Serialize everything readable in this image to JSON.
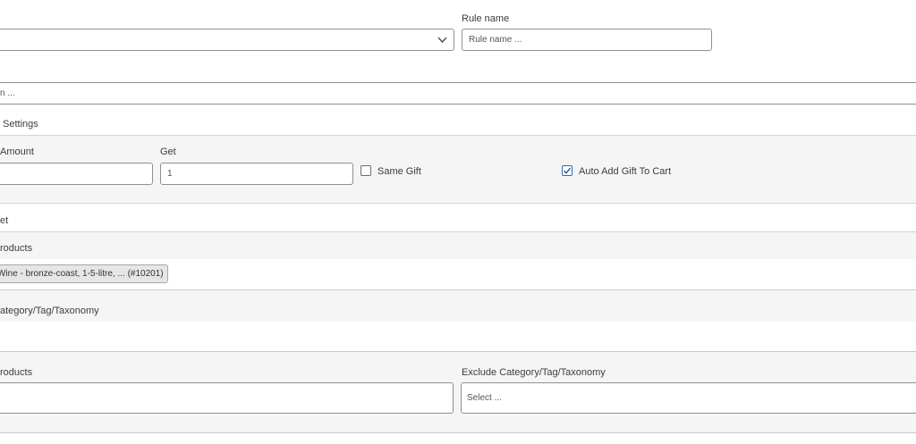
{
  "top_row": {
    "rule_name_label": "Rule name",
    "rule_name_placeholder": "Rule name ..."
  },
  "description_field": {
    "placeholder": "n ..."
  },
  "settings_header": {
    "label": "Settings"
  },
  "gift_settings": {
    "amount_label": "Amount",
    "amount_value": "",
    "get_label": "Get",
    "get_value": "1",
    "same_gift": {
      "label": "Same Gift",
      "checked": false
    },
    "auto_add": {
      "label": "Auto Add Gift To Cart",
      "checked": true
    }
  },
  "target_header": {
    "label": "et"
  },
  "products_section": {
    "label": "roducts",
    "selected_chip": "Wine - bronze-coast, 1-5-litre, ... (#10201)"
  },
  "category_section": {
    "label": "ategory/Tag/Taxonomy"
  },
  "exclude_section": {
    "products_label": "roducts",
    "category_label": "Exclude Category/Tag/Taxonomy",
    "category_placeholder": "Select ..."
  },
  "colors": {
    "band_grey": "#f5f5f5",
    "border": "#8c8f94",
    "divider": "#c9c9c9"
  },
  "icons": {
    "dropdown": "chevron-down-icon",
    "check": "checkmark-icon"
  }
}
